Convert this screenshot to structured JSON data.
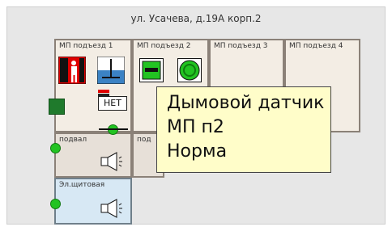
{
  "address": "ул. Усачева, д.19А корп.2",
  "cells": {
    "entrance1": "МП подъезд 1",
    "entrance2": "МП подъезд 2",
    "entrance3": "МП подъезд 3",
    "entrance4": "МП подъезд 4",
    "basement": "подвал",
    "basement2": "под",
    "electrical": "Эл.щитовая"
  },
  "badge": {
    "no": "НЕТ"
  },
  "tooltip": {
    "line1": "Дымовой датчик",
    "line2": "МП п2",
    "line3": "Норма"
  },
  "colors": {
    "status_ok": "#22c322",
    "alarm_red": "#e00000",
    "tooltip_bg": "#fffdc9"
  },
  "icons": [
    "person-exit-icon",
    "level-icon",
    "battery-icon",
    "green-square-icon",
    "green-circle-icon",
    "speaker-icon",
    "status-dot-icon"
  ]
}
